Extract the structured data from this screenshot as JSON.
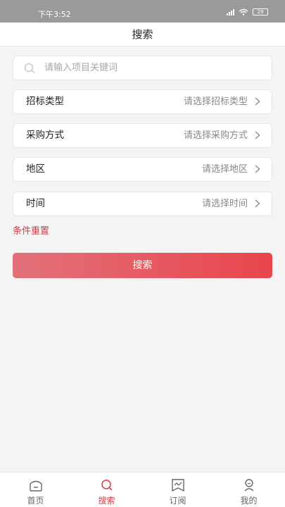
{
  "status": {
    "time": "下午3:52",
    "battery": "29"
  },
  "header": {
    "title": "搜索"
  },
  "search": {
    "placeholder": "请输入项目关键词"
  },
  "filters": [
    {
      "label": "招标类型",
      "value": "请选择招标类型"
    },
    {
      "label": "采购方式",
      "value": "请选择采购方式"
    },
    {
      "label": "地区",
      "value": "请选择地区"
    },
    {
      "label": "时间",
      "value": "请选择时间"
    }
  ],
  "reset_label": "条件重置",
  "search_button_label": "搜索",
  "tabs": [
    {
      "label": "首页",
      "icon": "home-icon",
      "active": false
    },
    {
      "label": "搜索",
      "icon": "search-icon",
      "active": true
    },
    {
      "label": "订阅",
      "icon": "subscribe-icon",
      "active": false
    },
    {
      "label": "我的",
      "icon": "profile-icon",
      "active": false
    }
  ],
  "colors": {
    "accent": "#d53a43",
    "button_start": "#e2717a",
    "button_end": "#e9454d"
  }
}
